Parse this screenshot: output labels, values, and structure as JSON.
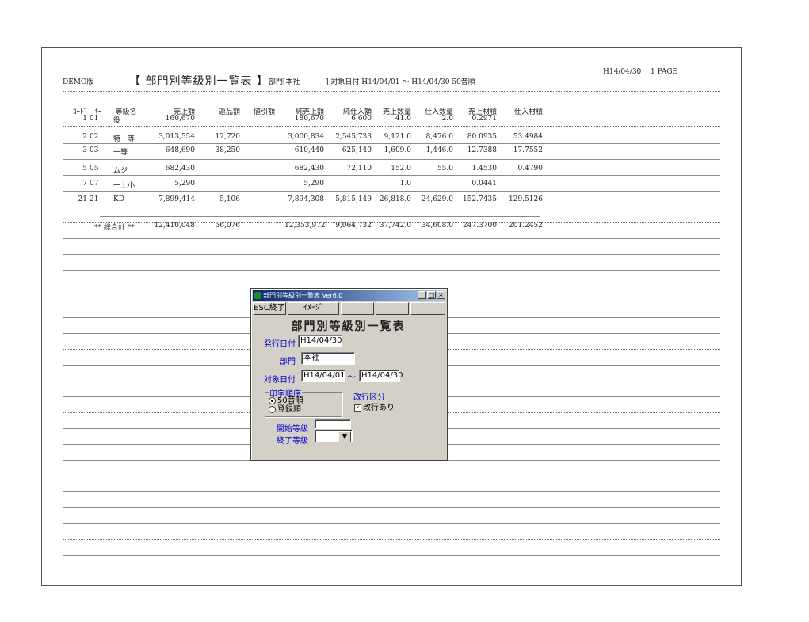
{
  "report": {
    "demo_label": "DEMO版",
    "title": "【 部門別等級別一覧表 】",
    "dept": "部門[本社",
    "range": "] 対象日付 H14/04/01 ～ H14/04/30 50音順",
    "date": "H14/04/30",
    "page": "1 PAGE"
  },
  "table": {
    "headers": [
      "ｺｰﾄﾞ",
      "ｷｰ",
      "等級名",
      "売上額",
      "返品額",
      "値引額",
      "純売上額",
      "純仕入額",
      "売上数量",
      "仕入数量",
      "売上材積",
      "仕入材積"
    ],
    "rows": [
      [
        "1",
        "01",
        "役",
        "160,670",
        "",
        "",
        "180,670",
        "6,600",
        "41.0",
        "2.0",
        "0.2971",
        ""
      ],
      [
        "2",
        "02",
        "特一等",
        "3,013,554",
        "12,720",
        "",
        "3,000,834",
        "2,545,733",
        "9,121.0",
        "8,476.0",
        "80.0935",
        "53.4984"
      ],
      [
        "3",
        "03",
        "一等",
        "648,690",
        "38,250",
        "",
        "610,440",
        "625,140",
        "1,609.0",
        "1,446.0",
        "12.7388",
        "17.7552"
      ],
      [
        "5",
        "05",
        "ムジ",
        "682,430",
        "",
        "",
        "682,430",
        "72,110",
        "152.0",
        "55.0",
        "1.4530",
        "0.4790"
      ],
      [
        "7",
        "07",
        "一上小",
        "5,290",
        "",
        "",
        "5,290",
        "",
        "1.0",
        "",
        "0.0441",
        ""
      ],
      [
        "21",
        "21",
        "KD",
        "7,899,414",
        "5,106",
        "",
        "7,894,308",
        "5,815,149",
        "26,818.0",
        "24,629.0",
        "152.7435",
        "129.5126"
      ]
    ],
    "total": [
      "** 総合計 **",
      "12,410,048",
      "56,076",
      "",
      "12,353,972",
      "9,064,732",
      "37,742.0",
      "34,608.0",
      "247.3700",
      "201.2452"
    ]
  },
  "dialog": {
    "window_title": "部門別等級別一覧表 Ver6.0",
    "esc_button": "ESC終了",
    "image_button": "ｲﾒｰｼﾞ",
    "heading": "部門別等級別一覧表",
    "issue_date_label": "発行日付",
    "issue_date_value": "H14/04/30",
    "dept_label": "部門",
    "dept_value": "本社",
    "target_date_label": "対象日付",
    "target_from": "H14/04/01",
    "tilde": "～",
    "target_to": "H14/04/30",
    "print_order_label": "印字順序",
    "order_option_1": "50音順",
    "order_option_2": "登録順",
    "page_break_label": "改行区分",
    "page_break_option": "改行あり",
    "check_mark": "✓",
    "start_grade_label": "開始等級",
    "end_grade_label": "終了等級",
    "minimize_glyph": "_",
    "maximize_glyph": "□",
    "close_glyph": "×",
    "dropdown_glyph": "▼"
  }
}
